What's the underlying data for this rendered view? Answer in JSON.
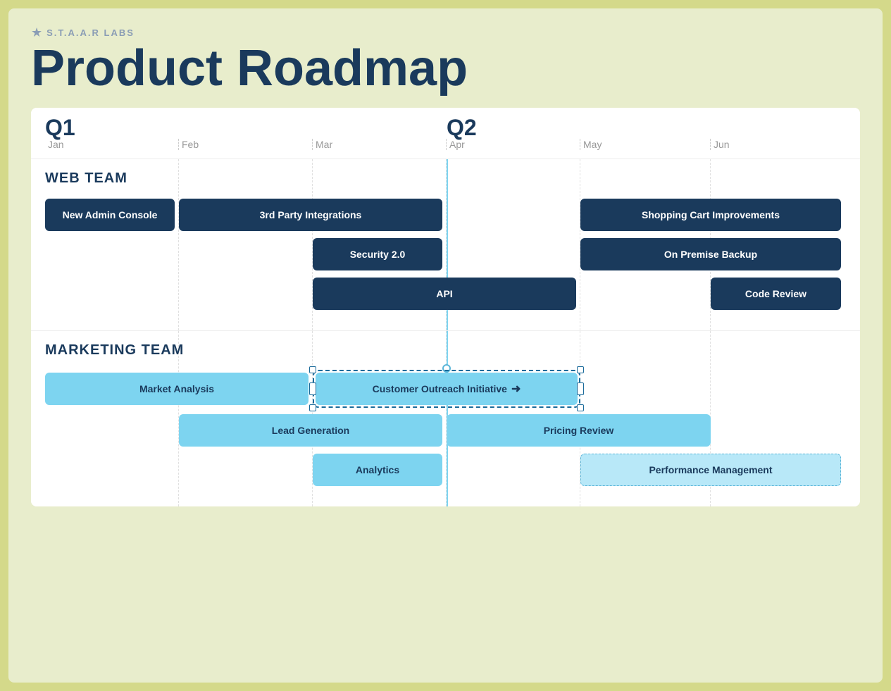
{
  "brand": {
    "name": "S.T.A.A.R LABS",
    "star": "★"
  },
  "title": "Product Roadmap",
  "quarters": [
    {
      "label": "Q1",
      "months": [
        "Jan",
        "Feb",
        "Mar"
      ]
    },
    {
      "label": "Q2",
      "months": [
        "Apr",
        "May",
        "Jun"
      ]
    }
  ],
  "months": [
    "Jan",
    "Feb",
    "Mar",
    "Apr",
    "May",
    "Jun"
  ],
  "teams": {
    "web": {
      "label": "WEB TEAM",
      "bars": [
        {
          "text": "New Admin Console",
          "col_start": 1,
          "col_span": 1,
          "type": "dark"
        },
        {
          "text": "3rd Party Integrations",
          "col_start": 2,
          "col_span": 2,
          "type": "dark"
        },
        {
          "text": "Shopping Cart Improvements",
          "col_start": 5,
          "col_span": 2,
          "type": "dark"
        },
        {
          "text": "Security 2.0",
          "col_start": 3,
          "col_span": 1,
          "type": "dark"
        },
        {
          "text": "On Premise Backup",
          "col_start": 5,
          "col_span": 2,
          "type": "dark"
        },
        {
          "text": "API",
          "col_start": 3,
          "col_span": 2,
          "type": "dark"
        },
        {
          "text": "Code Review",
          "col_start": 6,
          "col_span": 1,
          "type": "dark"
        }
      ],
      "rows": [
        [
          {
            "text": "New Admin Console",
            "col_start": 1,
            "col_span": 1,
            "type": "dark"
          },
          {
            "text": "3rd Party Integrations",
            "col_start": 2,
            "col_span": 2,
            "type": "dark"
          },
          {
            "text": "Shopping Cart Improvements",
            "col_start": 5,
            "col_span": 2,
            "type": "dark"
          }
        ],
        [
          {
            "text": "Security 2.0",
            "col_start": 3,
            "col_span": 1,
            "type": "dark"
          },
          {
            "text": "On Premise Backup",
            "col_start": 5,
            "col_span": 2,
            "type": "dark"
          }
        ],
        [
          {
            "text": "API",
            "col_start": 3,
            "col_span": 2,
            "type": "dark"
          },
          {
            "text": "Code Review",
            "col_start": 6,
            "col_span": 1,
            "type": "dark"
          }
        ]
      ]
    },
    "marketing": {
      "label": "MARKETING TEAM",
      "rows": [
        [
          {
            "text": "Market Analysis",
            "col_start": 1,
            "col_span": 2,
            "type": "light",
            "selected": true
          },
          {
            "text": "Customer Outreach Initiative",
            "col_start": 3,
            "col_span": 2,
            "type": "light",
            "selected": true,
            "has_arrow": true
          }
        ],
        [
          {
            "text": "Lead Generation",
            "col_start": 2,
            "col_span": 2,
            "type": "light"
          },
          {
            "text": "Pricing Review",
            "col_start": 4,
            "col_span": 2,
            "type": "light"
          }
        ],
        [
          {
            "text": "Analytics",
            "col_start": 3,
            "col_span": 1,
            "type": "light"
          },
          {
            "text": "Performance Management",
            "col_start": 5,
            "col_span": 2,
            "type": "light_outline"
          }
        ]
      ]
    }
  },
  "colors": {
    "dark_bar": "#1a3a5c",
    "light_bar": "#7dd4f0",
    "outline_bar": "#b8e8f8",
    "accent_line": "#7dd4f0",
    "bg": "#e8edcc",
    "title": "#1a3a5c"
  }
}
